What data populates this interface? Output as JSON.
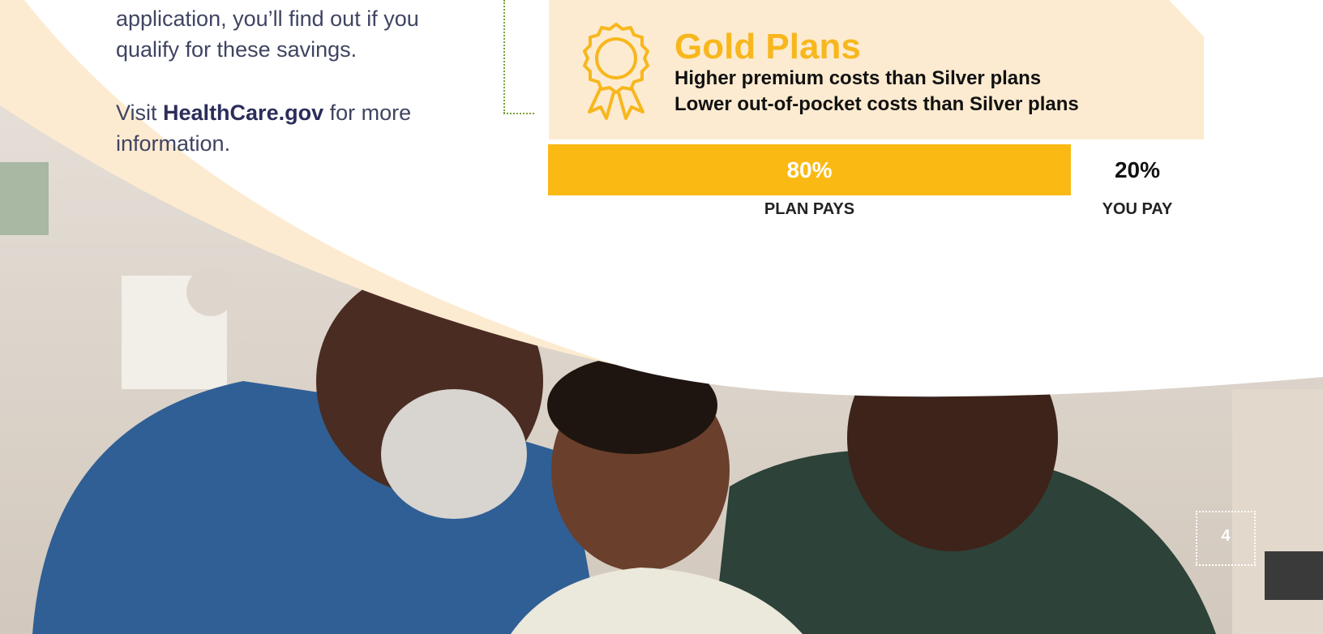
{
  "intro": {
    "line1": "application, you’ll find out if you",
    "line2": "qualify for these savings.",
    "visit_prefix": "Visit ",
    "visit_link": "HealthCare.gov",
    "visit_suffix": " for more",
    "visit_line2": "information."
  },
  "gold": {
    "title": "Gold Plans",
    "line1": "Higher premium costs than Silver plans",
    "line2": "Lower out-of-pocket costs than Silver plans"
  },
  "coverage": {
    "plan_share_percent": 80,
    "plan_pct_label": "80%",
    "you_pct_label": "20%",
    "plan_label": "PLAN PAYS",
    "you_label": "YOU PAY"
  },
  "page": {
    "number": "4"
  },
  "colors": {
    "gold": "#fbb913",
    "cream": "#fdebd1",
    "accent_text": "#2b2d5a"
  },
  "icons": {
    "award": "ribbon-award-icon"
  }
}
